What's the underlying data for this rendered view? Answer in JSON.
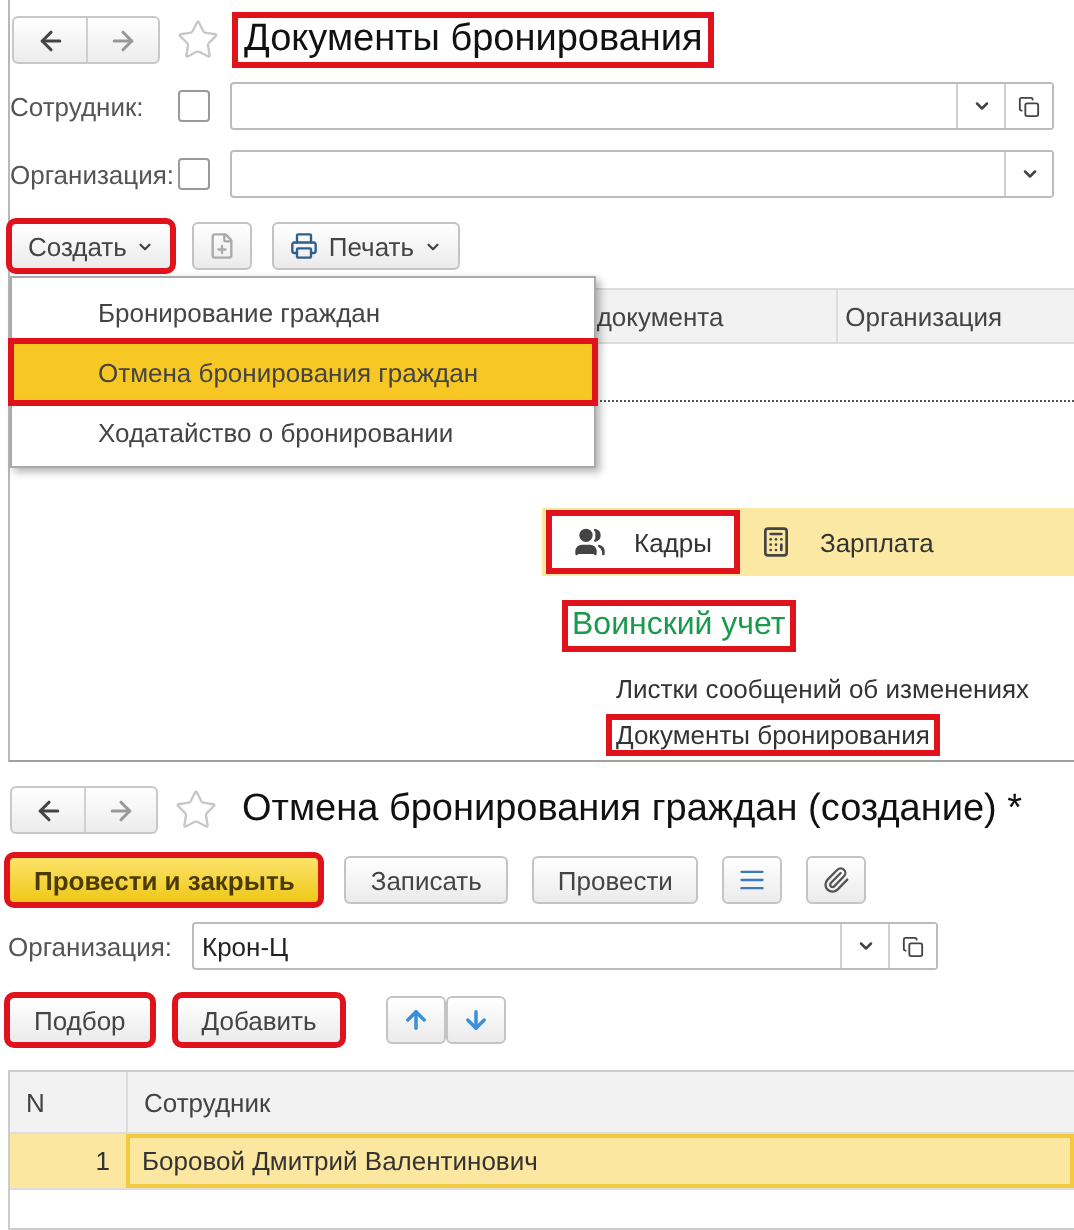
{
  "list_form": {
    "title": "Документы бронирования",
    "title_highlighted": true,
    "filters": [
      {
        "label": "Сотрудник:",
        "checked": false,
        "open_button": true
      },
      {
        "label": "Организация:",
        "checked": false,
        "open_button": false
      }
    ],
    "create_button": {
      "label": "Создать",
      "highlighted": true
    },
    "print_button": {
      "label": "Печать"
    },
    "columns": [
      "документа",
      "Организация"
    ],
    "create_menu": [
      {
        "label": "Бронирование граждан",
        "selected": false,
        "highlighted": false
      },
      {
        "label": "Отмена бронирования граждан",
        "selected": true,
        "highlighted": true
      },
      {
        "label": "Ходатайство о бронировании",
        "selected": false,
        "highlighted": false
      }
    ]
  },
  "sections_panel": {
    "tabs": [
      {
        "label": "Кадры",
        "selected": true,
        "highlighted": true
      },
      {
        "label": "Зарплата",
        "selected": false,
        "highlighted": false
      }
    ],
    "group": {
      "title": "Воинский учет",
      "highlighted": true
    },
    "links": [
      {
        "label": "Листки сообщений об изменениях",
        "highlighted": false
      },
      {
        "label": "Документы бронирования",
        "highlighted": true
      }
    ]
  },
  "document_form": {
    "title": "Отмена бронирования граждан (создание) *",
    "buttons": [
      {
        "label": "Провести и закрыть",
        "kind": "primary",
        "highlighted": true
      },
      {
        "label": "Записать",
        "kind": "normal",
        "highlighted": false
      },
      {
        "label": "Провести",
        "kind": "normal",
        "highlighted": false
      }
    ],
    "organization": {
      "label": "Организация:",
      "value": "Крон-Ц"
    },
    "table_buttons": [
      {
        "label": "Подбор",
        "highlighted": true
      },
      {
        "label": "Добавить",
        "highlighted": true
      }
    ],
    "columns": [
      "N",
      "Сотрудник"
    ],
    "rows": [
      {
        "n": "1",
        "employee": "Боровой Дмитрий Валентинович",
        "selected": true
      }
    ]
  }
}
